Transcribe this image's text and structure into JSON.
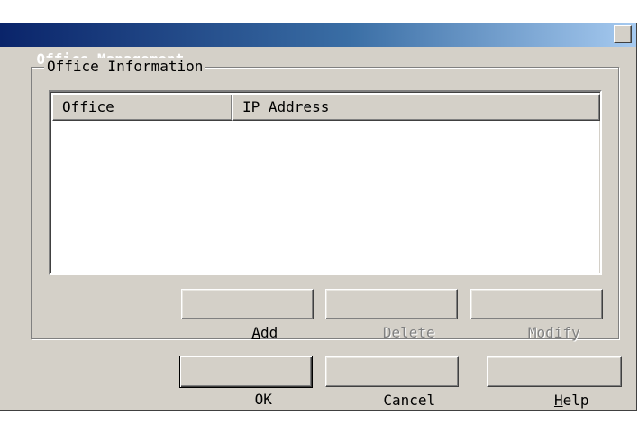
{
  "window": {
    "title": "Office Management",
    "close_glyph": "✕"
  },
  "group": {
    "legend": "Office Information"
  },
  "list": {
    "columns": [
      "Office",
      "IP Address"
    ],
    "rows": []
  },
  "group_buttons": {
    "add": {
      "accel": "A",
      "rest": "dd",
      "enabled": true
    },
    "delete": {
      "accel": "D",
      "rest": "elete",
      "enabled": false
    },
    "modify": {
      "accel": "M",
      "rest": "odify",
      "enabled": false
    }
  },
  "dialog_buttons": {
    "ok": "OK",
    "cancel": "Cancel",
    "help": {
      "accel": "H",
      "rest": "elp"
    }
  }
}
